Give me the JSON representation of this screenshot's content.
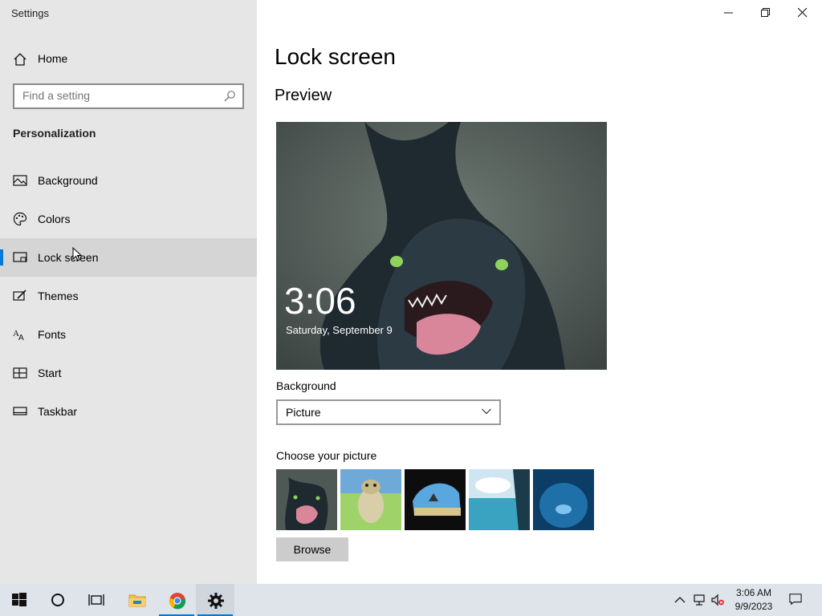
{
  "app": {
    "title": "Settings"
  },
  "sidebar": {
    "home_label": "Home",
    "search_placeholder": "Find a setting",
    "section_title": "Personalization",
    "items": [
      {
        "label": "Background",
        "icon": "picture-icon"
      },
      {
        "label": "Colors",
        "icon": "palette-icon"
      },
      {
        "label": "Lock screen",
        "icon": "lock-screen-icon",
        "active": true
      },
      {
        "label": "Themes",
        "icon": "brush-icon"
      },
      {
        "label": "Fonts",
        "icon": "font-icon"
      },
      {
        "label": "Start",
        "icon": "start-tiles-icon"
      },
      {
        "label": "Taskbar",
        "icon": "taskbar-icon"
      }
    ]
  },
  "main": {
    "title": "Lock screen",
    "preview_heading": "Preview",
    "preview": {
      "time": "3:06",
      "date": "Saturday, September 9"
    },
    "background_label": "Background",
    "background_value": "Picture",
    "choose_picture_label": "Choose your picture",
    "thumbnails": [
      "dragon-creature",
      "cartoon-creature",
      "beach-cave",
      "ocean-window",
      "underwater-diver"
    ],
    "browse_label": "Browse"
  },
  "taskbar": {
    "clock_time": "3:06 AM",
    "clock_date": "9/9/2023",
    "accent": "#0078d7"
  },
  "colors": {
    "sidebar_bg": "#e6e6e6",
    "accent": "#0078d7",
    "taskbar_bg": "#dfe4ea"
  }
}
